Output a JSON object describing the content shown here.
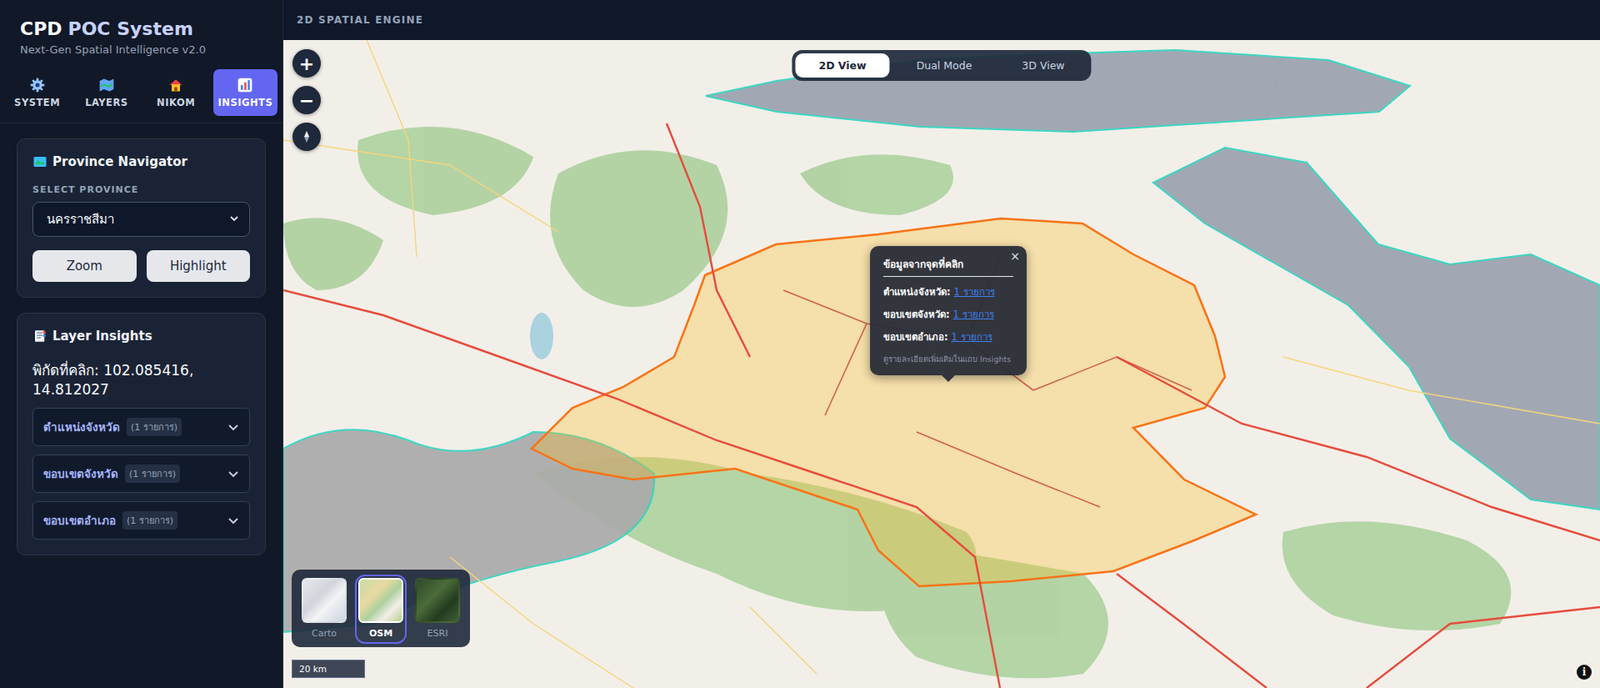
{
  "app": {
    "title_main": "CPD",
    "title_accent": "POC System",
    "subtitle": "Next-Gen Spatial Intelligence v2.0"
  },
  "tabs": [
    {
      "label": "SYSTEM",
      "selected": false,
      "kind": "gear"
    },
    {
      "label": "LAYERS",
      "selected": false,
      "kind": "map"
    },
    {
      "label": "NIKOM",
      "selected": false,
      "kind": "house"
    },
    {
      "label": "INSIGHTS",
      "selected": true,
      "kind": "chart"
    }
  ],
  "navigator": {
    "title": "Province Navigator",
    "select_label": "SELECT PROVINCE",
    "select_value": "นครราชสีมา",
    "buttons": [
      "Zoom",
      "Highlight"
    ]
  },
  "insights": {
    "title": "Layer Insights",
    "coord": "พิกัดที่คลิก: 102.085416, 14.812027",
    "items": [
      {
        "label": "ตำแหน่งจังหวัด",
        "count": "(1 รายการ)",
        "expanded": false
      },
      {
        "label": "ขอบเขตจังหวัด",
        "count": "(1 รายการ)",
        "expanded": false
      },
      {
        "label": "ขอบเขตอำเภอ",
        "count": "(1 รายการ)",
        "expanded": false
      }
    ]
  },
  "map": {
    "header": "2D SPATIAL ENGINE",
    "controls": [
      "+",
      "−"
    ],
    "view_modes": [
      {
        "label": "2D View",
        "selected": true
      },
      {
        "label": "Dual Mode",
        "selected": false
      },
      {
        "label": "3D View",
        "selected": false
      }
    ],
    "popup": {
      "title": "ข้อมูลจากจุดที่คลิก",
      "close": "×",
      "rows": [
        {
          "label": "ตำแหน่งจังหวัด:",
          "value": "1 รายการ"
        },
        {
          "label": "ขอบเขตจังหวัด:",
          "value": "1 รายการ"
        },
        {
          "label": "ขอบเขตอำเภอ:",
          "value": "1 รายการ"
        }
      ],
      "footer": "ดูรายละเอียดเพิ่มเติมในแถบ Insights"
    },
    "basemaps": [
      {
        "label": "Carto",
        "selected": false,
        "kind": "carto"
      },
      {
        "label": "OSM",
        "selected": true,
        "kind": "osm"
      },
      {
        "label": "ESRI",
        "selected": false,
        "kind": "esri"
      }
    ],
    "scale": "20 km",
    "info": "i"
  }
}
